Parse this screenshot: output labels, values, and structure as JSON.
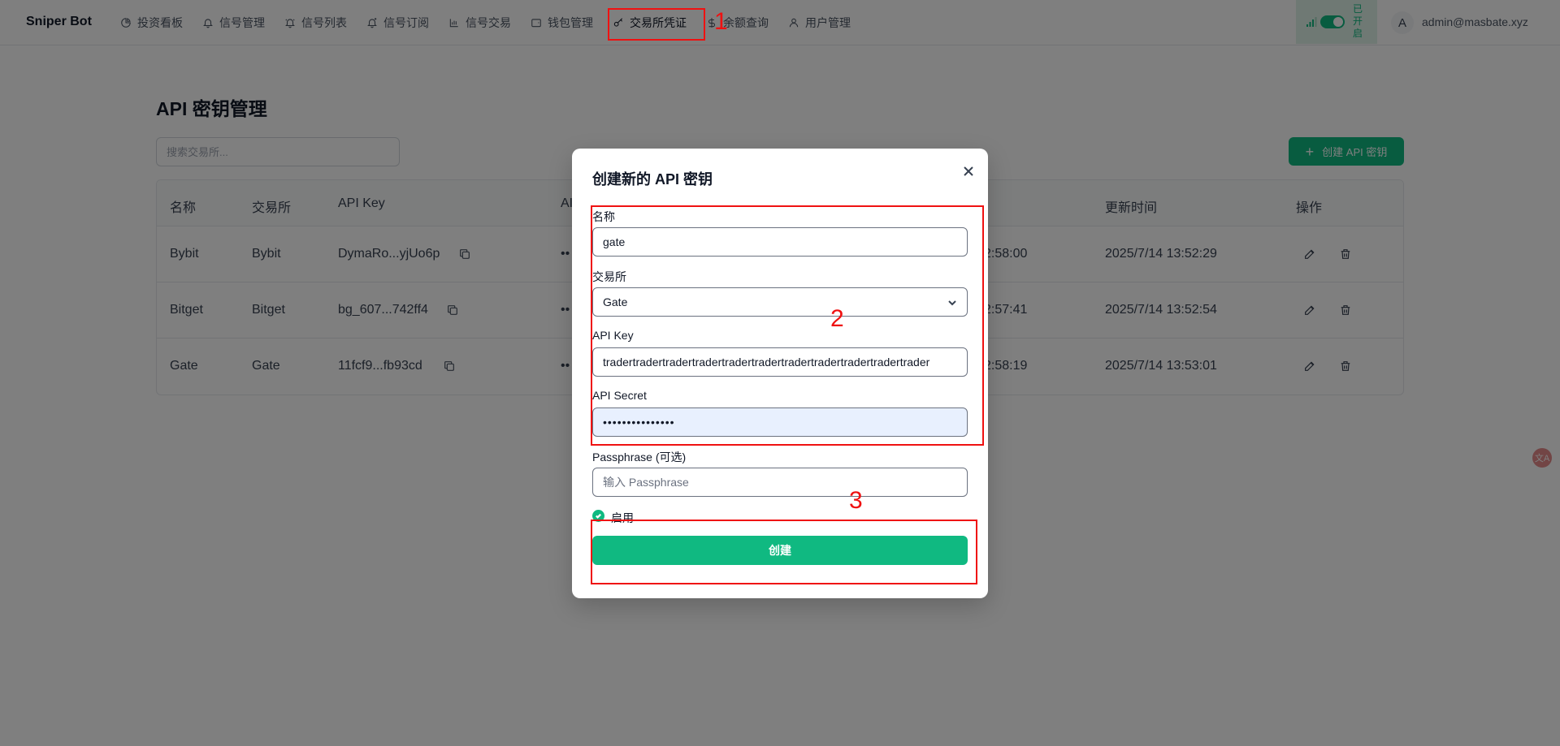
{
  "nav": {
    "brand": "Sniper Bot",
    "items": [
      {
        "label": "投资看板",
        "icon": "pie-chart-icon"
      },
      {
        "label": "信号管理",
        "icon": "bell-icon"
      },
      {
        "label": "信号列表",
        "icon": "bell-ring-icon"
      },
      {
        "label": "信号订阅",
        "icon": "bell-plus-icon"
      },
      {
        "label": "信号交易",
        "icon": "bar-chart-icon"
      },
      {
        "label": "钱包管理",
        "icon": "wallet-icon"
      },
      {
        "label": "交易所凭证",
        "icon": "key-icon"
      },
      {
        "label": "余额查询",
        "icon": "dollar-icon"
      },
      {
        "label": "用户管理",
        "icon": "user-icon"
      }
    ],
    "active_index": 6,
    "toggle_text": "已开启",
    "avatar": "A",
    "user_email": "admin@masbate.xyz"
  },
  "page": {
    "title": "API 密钥管理",
    "search_placeholder": "搜索交易所...",
    "create_button": "创建 API 密钥"
  },
  "table": {
    "headers": [
      "名称",
      "交易所",
      "API Key",
      "AI",
      "更新时间",
      "操作"
    ],
    "rows": [
      {
        "name": "Bybit",
        "exchange": "Bybit",
        "api_key": "DymaRo...yjUo6p",
        "masked": "••",
        "created_tail": "2:58:00",
        "updated": "2025/7/14 13:52:29"
      },
      {
        "name": "Bitget",
        "exchange": "Bitget",
        "api_key": "bg_607...742ff4",
        "masked": "••",
        "created_tail": "2:57:41",
        "updated": "2025/7/14 13:52:54"
      },
      {
        "name": "Gate",
        "exchange": "Gate",
        "api_key": "11fcf9...fb93cd",
        "masked": "••",
        "created_tail": "2:58:19",
        "updated": "2025/7/14 13:53:01"
      }
    ]
  },
  "modal": {
    "title": "创建新的 API 密钥",
    "name_label": "名称",
    "name_value": "gate",
    "exchange_label": "交易所",
    "exchange_value": "Gate",
    "api_key_label": "API Key",
    "api_key_value": "tradertradertradertradertradertradertradertradertradertradertrader",
    "api_secret_label": "API Secret",
    "api_secret_value": "•••••••••••••••",
    "passphrase_label": "Passphrase (可选)",
    "passphrase_placeholder": "输入 Passphrase",
    "enabled_label": "启用",
    "submit_label": "创建"
  },
  "annotations": [
    "1",
    "2",
    "3"
  ],
  "side_widget": "文A",
  "colors": {
    "accent": "#10b981",
    "annotation": "#ef1111"
  }
}
